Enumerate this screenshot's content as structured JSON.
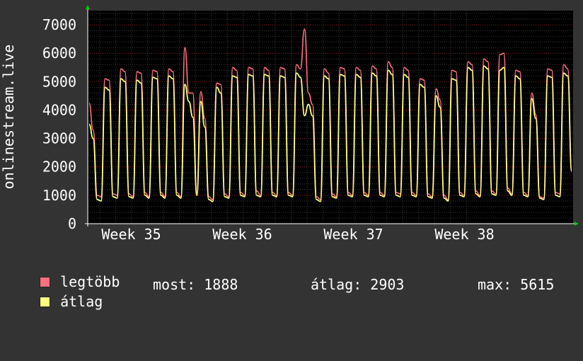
{
  "chart_data": {
    "type": "line",
    "ylabel": "onlinestream.live",
    "ylim": [
      0,
      7500
    ],
    "yticks": [
      0,
      1000,
      2000,
      3000,
      4000,
      5000,
      6000,
      7000
    ],
    "x_ticks": [
      "Week 35",
      "Week 36",
      "Week 37",
      "Week 38"
    ],
    "grid": true,
    "series": [
      {
        "name": "legtöbb",
        "color": "#ff7080",
        "values": [
          4250,
          3300,
          1000,
          950,
          5100,
          5050,
          1050,
          1000,
          5450,
          5350,
          1050,
          950,
          5350,
          5300,
          1100,
          950,
          5400,
          5350,
          1100,
          950,
          5450,
          5350,
          1100,
          950,
          6200,
          4600,
          4600,
          1100,
          4650,
          3700,
          950,
          850,
          4950,
          4900,
          1050,
          950,
          5500,
          5400,
          1100,
          1000,
          5500,
          5450,
          1150,
          1000,
          5500,
          5400,
          1100,
          1000,
          5500,
          5450,
          1100,
          1000,
          5600,
          5450,
          6850,
          4600,
          4200,
          950,
          850,
          5450,
          5300,
          1050,
          950,
          5500,
          5450,
          1100,
          1000,
          5500,
          5400,
          1100,
          1000,
          5550,
          5450,
          1100,
          1000,
          5700,
          5500,
          1100,
          1050,
          5500,
          5400,
          1100,
          1000,
          5100,
          5050,
          1050,
          950,
          4750,
          4350,
          1000,
          850,
          5400,
          5350,
          1100,
          1000,
          5700,
          5600,
          1150,
          1000,
          5800,
          5700,
          1150,
          1050,
          5950,
          6000,
          1250,
          1050,
          5400,
          5350,
          1100,
          1000,
          4600,
          3850,
          950,
          900,
          5450,
          5400,
          1100,
          1050,
          5600,
          5450,
          1850
        ]
      },
      {
        "name": "átlag",
        "color": "#ffff80",
        "values": [
          3500,
          3000,
          850,
          800,
          4800,
          4700,
          950,
          900,
          5100,
          5000,
          950,
          900,
          5050,
          4950,
          1000,
          900,
          5150,
          5100,
          1000,
          900,
          5200,
          5100,
          1000,
          900,
          4900,
          4300,
          3750,
          1000,
          4300,
          3400,
          850,
          780,
          4800,
          4600,
          950,
          900,
          5200,
          5150,
          1000,
          950,
          5250,
          5200,
          1000,
          950,
          5250,
          5200,
          1000,
          950,
          5200,
          5150,
          1000,
          950,
          5300,
          5150,
          3800,
          4200,
          3800,
          850,
          780,
          5200,
          5100,
          950,
          900,
          5250,
          5200,
          1000,
          950,
          5250,
          5150,
          1000,
          950,
          5300,
          5200,
          1000,
          950,
          5400,
          5250,
          1000,
          950,
          5250,
          5150,
          1000,
          950,
          4900,
          4800,
          950,
          900,
          4500,
          4100,
          900,
          800,
          5100,
          5050,
          1000,
          950,
          5500,
          5400,
          1050,
          950,
          5550,
          5450,
          1050,
          1000,
          5400,
          5500,
          1150,
          1000,
          5200,
          5100,
          1000,
          950,
          4400,
          3700,
          900,
          850,
          5200,
          5150,
          1000,
          950,
          5300,
          5200,
          1850
        ]
      }
    ],
    "stats": {
      "most_label": "most:",
      "most_value": "1888",
      "atlag_label": "átlag:",
      "atlag_value": "2903",
      "max_label": "max:",
      "max_value": "5615"
    }
  }
}
